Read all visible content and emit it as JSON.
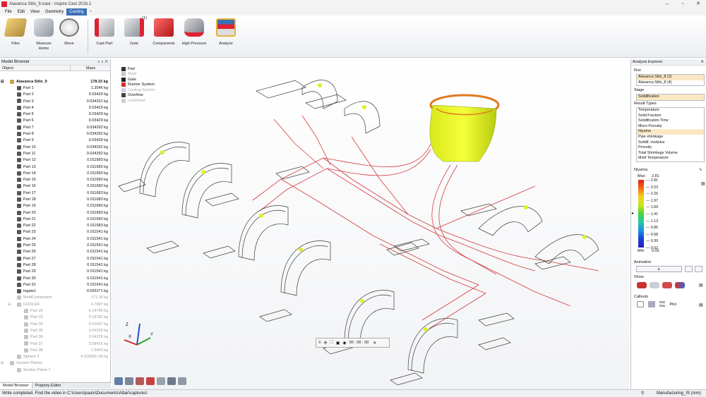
{
  "app": {
    "title": "Alavanca Stilo_9.icast - Inspire Cast 2016.1"
  },
  "menu": [
    "File",
    "Edit",
    "View",
    "Geometry",
    "Casting"
  ],
  "menu_active": "Casting",
  "ribbon": [
    {
      "label": "Files",
      "icon": "files-icon"
    },
    {
      "label": "Measure Home",
      "icon": "measure-icon"
    },
    {
      "label": "Move",
      "icon": "move-icon"
    },
    {
      "label": "Cast Part",
      "icon": "cast-part-icon"
    },
    {
      "label": "Gate",
      "icon": "gate-icon",
      "badge": "(1)"
    },
    {
      "label": "Components",
      "icon": "components-icon"
    },
    {
      "label": "High Pressure",
      "icon": "high-pressure-icon"
    },
    {
      "label": "Analyze",
      "icon": "analyze-icon"
    }
  ],
  "model_browser": {
    "title": "Model Browser",
    "col_object": "Object",
    "col_mass": "Mass",
    "rows": [
      {
        "name": "Alavanca Stilo_9",
        "mass": "178.15 kg",
        "level": 0,
        "type": "root"
      },
      {
        "name": "Part 1",
        "mass": "1.3546 kg",
        "level": 1
      },
      {
        "name": "Part 2",
        "mass": "0.03429 kg",
        "level": 1
      },
      {
        "name": "Part 3",
        "mass": "0.034291 kg",
        "level": 1
      },
      {
        "name": "Part 4",
        "mass": "0.03429 kg",
        "level": 1
      },
      {
        "name": "Part 5",
        "mass": "0.03429 kg",
        "level": 1
      },
      {
        "name": "Part 6",
        "mass": "0.03429 kg",
        "level": 1
      },
      {
        "name": "Part 7",
        "mass": "0.034292 kg",
        "level": 1
      },
      {
        "name": "Part 8",
        "mass": "0.034292 kg",
        "level": 1
      },
      {
        "name": "Part 9",
        "mass": "0.03429 kg",
        "level": 1
      },
      {
        "name": "Part 10",
        "mass": "0.034292 kg",
        "level": 1
      },
      {
        "name": "Part 11",
        "mass": "0.034292 kg",
        "level": 1
      },
      {
        "name": "Part 12",
        "mass": "0.011683 kg",
        "level": 1
      },
      {
        "name": "Part 13",
        "mass": "0.011683 kg",
        "level": 1
      },
      {
        "name": "Part 14",
        "mass": "0.011683 kg",
        "level": 1
      },
      {
        "name": "Part 15",
        "mass": "0.011683 kg",
        "level": 1
      },
      {
        "name": "Part 16",
        "mass": "0.011683 kg",
        "level": 1
      },
      {
        "name": "Part 17",
        "mass": "0.011683 kg",
        "level": 1
      },
      {
        "name": "Part 18",
        "mass": "0.011683 kg",
        "level": 1
      },
      {
        "name": "Part 19",
        "mass": "0.011683 kg",
        "level": 1
      },
      {
        "name": "Part 20",
        "mass": "0.011683 kg",
        "level": 1
      },
      {
        "name": "Part 21",
        "mass": "0.011683 kg",
        "level": 1
      },
      {
        "name": "Part 22",
        "mass": "0.011683 kg",
        "level": 1
      },
      {
        "name": "Part 23",
        "mass": "0.011541 kg",
        "level": 1
      },
      {
        "name": "Part 24",
        "mass": "0.011541 kg",
        "level": 1
      },
      {
        "name": "Part 25",
        "mass": "0.011541 kg",
        "level": 1
      },
      {
        "name": "Part 26",
        "mass": "0.011541 kg",
        "level": 1
      },
      {
        "name": "Part 27",
        "mass": "0.011541 kg",
        "level": 1
      },
      {
        "name": "Part 28",
        "mass": "0.011541 kg",
        "level": 1
      },
      {
        "name": "Part 29",
        "mass": "0.011541 kg",
        "level": 1
      },
      {
        "name": "Part 30",
        "mass": "0.011541 kg",
        "level": 1
      },
      {
        "name": "Part 31",
        "mass": "0.011541 kg",
        "level": 1
      },
      {
        "name": "ingate1",
        "mass": "0.092271 kg",
        "level": 1
      },
      {
        "name": "MoldComponent",
        "mass": "171.36 kg",
        "level": 1,
        "dim": true
      },
      {
        "name": "COOLER",
        "mass": "4.7697 kg",
        "level": 1,
        "dim": true,
        "type": "group"
      },
      {
        "name": "Part 32",
        "mass": "0.14796 kg",
        "level": 2,
        "dim": true
      },
      {
        "name": "Part 33",
        "mass": "0.19792 kg",
        "level": 2,
        "dim": true
      },
      {
        "name": "Part 34",
        "mass": "0.01947 kg",
        "level": 2,
        "dim": true
      },
      {
        "name": "Part 35",
        "mass": "0.04226 kg",
        "level": 2,
        "dim": true
      },
      {
        "name": "Part 36",
        "mass": "0.04225 kg",
        "level": 2,
        "dim": true
      },
      {
        "name": "Part 37",
        "mass": "0.58425 kg",
        "level": 2,
        "dim": true
      },
      {
        "name": "Part 38",
        "mass": "1.3403 kg",
        "level": 2,
        "dim": true
      },
      {
        "name": "Sphere 3",
        "mass": "4.12992E-05 kg",
        "level": 1,
        "dim": true
      },
      {
        "name": "Section Planes",
        "mass": "",
        "level": 0,
        "dim": true,
        "type": "group"
      },
      {
        "name": "Section Plane 1",
        "mass": "",
        "level": 1,
        "dim": true
      }
    ],
    "tabs": [
      "Model Browser",
      "Property Editor"
    ]
  },
  "legend": [
    {
      "label": "Part",
      "color": "#333333"
    },
    {
      "label": "Mold",
      "color": "#c8c8c8",
      "dim": true
    },
    {
      "label": "Gate",
      "color": "#222222"
    },
    {
      "label": "Runner System",
      "color": "#d42b2b"
    },
    {
      "label": "Cooling System",
      "color": "#c9d3e6",
      "dim": true
    },
    {
      "label": "Overflow",
      "color": "#444444"
    },
    {
      "label": "Undefined",
      "color": "#cfcfcf",
      "dim": true
    }
  ],
  "playback": {
    "time": "00 : 00 : 00"
  },
  "analysis": {
    "title": "Analysis Explorer",
    "run_label": "Run",
    "runs": [
      "Alavanca Stilo_8 (3)",
      "Alavanca Stilo_8 (4)"
    ],
    "stage_label": "Stage",
    "stage": "Solidification",
    "result_types_label": "Result Types",
    "result_types": [
      "Temperature",
      "Solid Fraction",
      "Solidification Time",
      "Micro Porosity",
      "Niyama",
      "Pipe shrinkage",
      "Solidif. modulus",
      "Porosity",
      "Total Shrinkage Volume",
      "Mold Temperature"
    ],
    "selected_result": "Niyama",
    "scale_title": "Niyama:",
    "max_label": "Max:",
    "max_value": "2.81",
    "min_label": "Min:",
    "min_value": "0.02",
    "scale_values": [
      "2.81",
      "2.53",
      "2.25",
      "1.97",
      "1.69",
      "1.41",
      "1.13",
      "0.86",
      "0.58",
      "0.30",
      "0.02"
    ],
    "animation_label": "Animation",
    "show_label": "Show",
    "callouts_label": "Callouts",
    "minmax_label": "Min/\nMax",
    "plot_label": "Plot"
  },
  "status": {
    "message": "Write completed. Find the video in C:\\Users\\paulo\\Documents\\Altair\\captures\\",
    "units": "Manufacturing_IS (mm)"
  }
}
